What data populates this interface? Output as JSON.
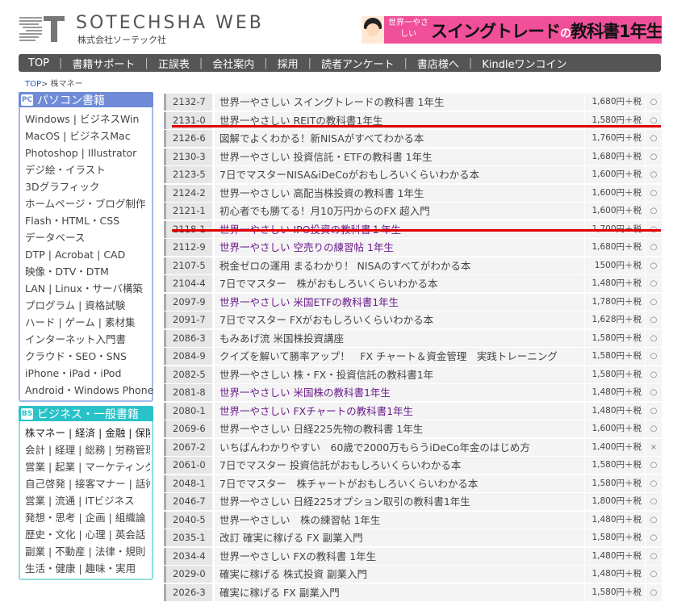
{
  "header": {
    "site_title": "SOTECHSHA WEB",
    "company": "株式会社ソーテック社",
    "banner": {
      "small_text": "世界一やさしい",
      "big_text": "スイングトレード",
      "no": "の",
      "rest": "教科書1年生"
    }
  },
  "nav": {
    "items": [
      "TOP",
      "書籍サポート",
      "正誤表",
      "会社案内",
      "採用",
      "読者アンケート",
      "書店様へ",
      "Kindleワンコイン"
    ]
  },
  "breadcrumb": {
    "home": "TOP",
    "current": "株マネー",
    "separator": ">"
  },
  "sidebar": {
    "pc": {
      "badge": "PC",
      "title": "パソコン書籍",
      "items": [
        "Windows | ビジネスWin",
        "MacOS | ビジネスMac",
        "Photoshop | Illustrator",
        "デジ絵・イラスト",
        "3Dグラフィック",
        "ホームページ・ブログ制作",
        "Flash・HTML・CSS",
        "データベース",
        "DTP | Acrobat | CAD",
        "映像・DTV・DTM",
        "LAN | Linux・サーバ構築",
        "プログラム | 資格試験",
        "ハード | ゲーム | 素材集",
        "インターネット入門書",
        "クラウド・SEO・SNS",
        "iPhone・iPad・iPod",
        "Android・Windows Phone"
      ]
    },
    "biz": {
      "badge": "BS",
      "title": "ビジネス・一般書籍",
      "items": [
        "株マネー | 経済 | 金融 | 保険",
        "会計 | 経理 | 総務 | 労務管理",
        "営業 | 起業 | マーケティング",
        "自己啓発 | 接客マナー | 話術",
        "営業 | 流通 | ITビジネス",
        "発想・思考 | 企画 | 組織論",
        "歴史・文化 | 心理 | 英会話",
        "副業 | 不動産 | 法律・規則",
        "生活・健康 | 趣味・実用"
      ]
    }
  },
  "books": [
    {
      "code": "2132-7",
      "title": "世界一やさしい スイングトレードの教科書 1年生",
      "price": "1,680円＋税",
      "stock": "○",
      "new": false
    },
    {
      "code": "2131-0",
      "title": "世界一やさしい REITの教科書1年生",
      "price": "1,580円＋税",
      "stock": "○",
      "new": false
    },
    {
      "code": "2126-6",
      "title": "図解でよくわかる！新NISAがすべてわかる本",
      "price": "1,760円＋税",
      "stock": "○",
      "new": false
    },
    {
      "code": "2130-3",
      "title": "世界一やさしい 投資信託・ETFの教科書 1年生",
      "price": "1,680円＋税",
      "stock": "○",
      "new": false
    },
    {
      "code": "2123-5",
      "title": "7日でマスターNISA&iDeCoがおもしろいくらいわかる本",
      "price": "1,600円＋税",
      "stock": "○",
      "new": false
    },
    {
      "code": "2124-2",
      "title": "世界一やさしい 高配当株投資の教科書 1年生",
      "price": "1,600円＋税",
      "stock": "○",
      "new": false
    },
    {
      "code": "2121-1",
      "title": "初心者でも勝てる！月10万円からのFX 超入門",
      "price": "1,600円＋税",
      "stock": "○",
      "new": false
    },
    {
      "code": "2118-1",
      "title": "世界一やさしい IPO投資の教科書１年生",
      "price": "1,700円＋税",
      "stock": "○",
      "new": true
    },
    {
      "code": "2112-9",
      "title": "世界一やさしい 空売りの練習帖 1年生",
      "price": "1,680円＋税",
      "stock": "○",
      "new": true
    },
    {
      "code": "2107-5",
      "title": "税金ゼロの運用 まるわかり！ NISAのすべてがわかる本",
      "price": "1500円＋税",
      "stock": "○",
      "new": false
    },
    {
      "code": "2104-4",
      "title": "7日でマスター　株がおもしろいくらいわかる本",
      "price": "1,480円＋税",
      "stock": "○",
      "new": false
    },
    {
      "code": "2097-9",
      "title": "世界一やさしい 米国ETFの教科書1年生",
      "price": "1,780円＋税",
      "stock": "○",
      "new": true
    },
    {
      "code": "2091-7",
      "title": "7日でマスター FXがおもしろいくらいわかる本",
      "price": "1,628円＋税",
      "stock": "○",
      "new": false
    },
    {
      "code": "2086-3",
      "title": "もみあげ流 米国株投資講座",
      "price": "1,580円＋税",
      "stock": "○",
      "new": false
    },
    {
      "code": "2084-9",
      "title": "クイズを解いて勝率アップ！　FX チャート＆資金管理　実践トレーニング",
      "price": "1,580円＋税",
      "stock": "○",
      "new": false
    },
    {
      "code": "2082-5",
      "title": "世界一やさしい 株・FX・投資信託の教科書1年",
      "price": "1,580円＋税",
      "stock": "○",
      "new": false
    },
    {
      "code": "2081-8",
      "title": "世界一やさしい 米国株の教科書1年生",
      "price": "1,480円＋税",
      "stock": "○",
      "new": true
    },
    {
      "code": "2080-1",
      "title": "世界一やさしい FXチャートの教科書1年生",
      "price": "1,480円＋税",
      "stock": "○",
      "new": true
    },
    {
      "code": "2069-6",
      "title": "世界一やさしい 日経225先物の教科書 1年生",
      "price": "1,600円＋税",
      "stock": "○",
      "new": false
    },
    {
      "code": "2067-2",
      "title": "いちばんわかりやすい　60歳で2000万もらうiDeCo年金のはじめ方",
      "price": "1,400円＋税",
      "stock": "×",
      "new": false
    },
    {
      "code": "2061-0",
      "title": "7日でマスター 投資信託がおもしろいくらいわかる本",
      "price": "1,580円＋税",
      "stock": "○",
      "new": false
    },
    {
      "code": "2048-1",
      "title": "7日でマスター　株チャートがおもしろいくらいわかる本",
      "price": "1,580円＋税",
      "stock": "○",
      "new": false
    },
    {
      "code": "2046-7",
      "title": "世界一やさしい 日経225オプション取引の教科書1年生",
      "price": "1,800円＋税",
      "stock": "○",
      "new": false
    },
    {
      "code": "2040-5",
      "title": "世界一やさしい　株の練習帖 1年生",
      "price": "1,480円＋税",
      "stock": "○",
      "new": false
    },
    {
      "code": "2035-1",
      "title": "改訂 確実に稼げる FX 副業入門",
      "price": "1,580円＋税",
      "stock": "○",
      "new": false
    },
    {
      "code": "2034-4",
      "title": "世界一やさしい FXの教科書 1年生",
      "price": "1,480円＋税",
      "stock": "○",
      "new": false
    },
    {
      "code": "2029-0",
      "title": "確実に稼げる 株式投資 副業入門",
      "price": "1,480円＋税",
      "stock": "○",
      "new": false
    },
    {
      "code": "2026-3",
      "title": "確実に稼げる FX 副業入門",
      "price": "1,580円＋税",
      "stock": "○",
      "new": false
    }
  ],
  "colors": {
    "nav_bg": "#555555",
    "pc_accent": "#6f8bd8",
    "biz_accent": "#29c2c8",
    "new_title": "#6a1b8a",
    "annotation_red": "#e00000"
  }
}
